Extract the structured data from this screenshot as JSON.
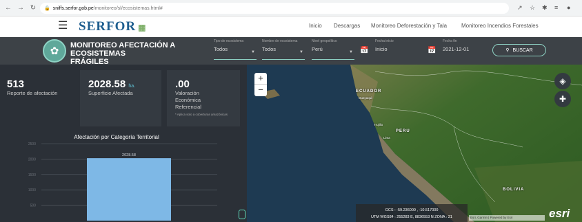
{
  "browser": {
    "url_domain": "sniffs.serfor.gob.pe",
    "url_path": "/monitoreo/sl/ecosistemas.html#",
    "back_icon": "arrow-left-icon",
    "forward_icon": "arrow-right-icon",
    "reload_icon": "reload-icon"
  },
  "site": {
    "logo_text": "SERFOR",
    "menu": [
      "Inicio",
      "Descargas",
      "Monitoreo Deforestación y Tala",
      "Monitoreo Incendios Forestales"
    ]
  },
  "banner": {
    "title_line1": "MONITOREO AFECTACIÓN A ECOSISTEMAS",
    "title_line2": "FRÁGILES",
    "filters": {
      "tipo": {
        "label": "Tipo de ecosistema",
        "value": "Todos"
      },
      "nombre": {
        "label": "Nombre de ecosistema",
        "value": "Todos"
      },
      "nivel": {
        "label": "Nivel geopolítico",
        "value": "Perú"
      },
      "inicio": {
        "label": "Fecha inicio",
        "value": "Inicio"
      },
      "fin": {
        "label": "Fecha fin",
        "value": "2021-12-01"
      }
    },
    "search_label": "BUSCAR"
  },
  "stats": [
    {
      "value": "513",
      "unit": "",
      "label": "Reporte de afectación",
      "note": ""
    },
    {
      "value": "2028.58",
      "unit": "ha.",
      "label": "Superficie Afectada",
      "note": ""
    },
    {
      "value": ".00",
      "unit": "",
      "label": "Valoración Económica Referencial",
      "note": "* Aplica solo a coberturas amazónicas"
    }
  ],
  "chart_data": {
    "type": "bar",
    "title": "Afectación por Categoría Territorial",
    "categories": [
      ""
    ],
    "values": [
      2028.58
    ],
    "data_labels": [
      "2028.58"
    ],
    "ylim": [
      0,
      2500
    ],
    "yticks": [
      2500,
      2000,
      1500,
      1000,
      500
    ],
    "ylabel": "",
    "grid": true,
    "bar_color": "#7eb8e6"
  },
  "map": {
    "labels": [
      "ECUADOR",
      "PERU",
      "BOLIVIA"
    ],
    "small_labels": [
      "Guayaquil",
      "Trujillo",
      "Lima"
    ],
    "coords_line1": "GCS : -59.236000 , -10.517000",
    "coords_line2": "UTM WGS84 : 255283 E, 8836553 N ZONA : 21",
    "attribution": "Esri, Garmin | Powered by Esri",
    "esri_logo": "esri",
    "zoom_in": "+",
    "zoom_out": "−"
  }
}
